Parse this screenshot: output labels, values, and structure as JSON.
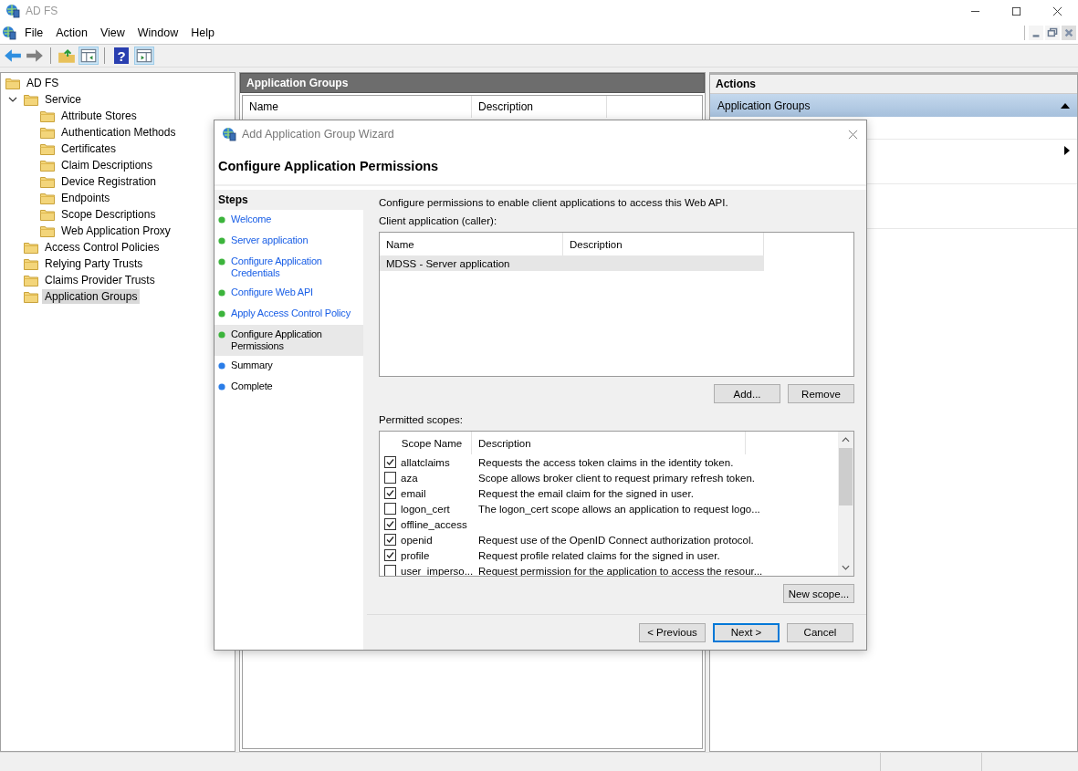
{
  "window": {
    "title": "AD FS"
  },
  "menu": [
    "File",
    "Action",
    "View",
    "Window",
    "Help"
  ],
  "toolbar": {
    "help_glyph": "?"
  },
  "tree": [
    {
      "label": "AD FS",
      "selected": false,
      "children": [
        {
          "label": "Service",
          "selected": false,
          "expanded": true,
          "children": [
            {
              "label": "Attribute Stores",
              "selected": false
            },
            {
              "label": "Authentication Methods",
              "selected": false
            },
            {
              "label": "Certificates",
              "selected": false
            },
            {
              "label": "Claim Descriptions",
              "selected": false
            },
            {
              "label": "Device Registration",
              "selected": false
            },
            {
              "label": "Endpoints",
              "selected": false
            },
            {
              "label": "Scope Descriptions",
              "selected": false
            },
            {
              "label": "Web Application Proxy",
              "selected": false
            }
          ]
        },
        {
          "label": "Access Control Policies",
          "selected": false
        },
        {
          "label": "Relying Party Trusts",
          "selected": false
        },
        {
          "label": "Claims Provider Trusts",
          "selected": false
        },
        {
          "label": "Application Groups",
          "selected": true
        }
      ]
    }
  ],
  "center": {
    "title": "Application Groups",
    "columns": [
      "Name",
      "Description"
    ]
  },
  "actions": {
    "title": "Actions",
    "section": "Application Groups",
    "expanded": true
  },
  "dialog": {
    "title": "Add Application Group Wizard",
    "heading": "Configure Application Permissions",
    "steps_title": "Steps",
    "steps": [
      {
        "label": "Welcome",
        "color": "#3cb43c",
        "selected": false
      },
      {
        "label": "Server application",
        "color": "#3cb43c",
        "selected": false
      },
      {
        "label": "Configure Application Credentials",
        "color": "#3cb43c",
        "selected": false
      },
      {
        "label": "Configure Web API",
        "color": "#3cb43c",
        "selected": false
      },
      {
        "label": "Apply Access Control Policy",
        "color": "#3cb43c",
        "selected": false
      },
      {
        "label": "Configure Application Permissions",
        "color": "#3cb43c",
        "selected": true
      },
      {
        "label": "Summary",
        "color": "#2a7de8",
        "selected": false
      },
      {
        "label": "Complete",
        "color": "#2a7de8",
        "selected": false
      }
    ],
    "intro": "Configure permissions to enable client applications to access this Web API.",
    "client_label": "Client application (caller):",
    "client_columns": [
      "Name",
      "Description"
    ],
    "client_rows": [
      {
        "name": "MDSS - Server application",
        "selected": true
      }
    ],
    "client_buttons": [
      "Add...",
      "Remove"
    ],
    "scopes_label": "Permitted scopes:",
    "scope_columns": [
      "Scope Name",
      "Description"
    ],
    "scopes": [
      {
        "name": "allatclaims",
        "description": "Requests the access token claims in the identity token.",
        "checked": true
      },
      {
        "name": "aza",
        "description": "Scope allows broker client to request primary refresh token.",
        "checked": false
      },
      {
        "name": "email",
        "description": "Request the email claim for the signed in user.",
        "checked": true
      },
      {
        "name": "logon_cert",
        "description": "The logon_cert scope allows an application to request logo...",
        "checked": false
      },
      {
        "name": "offline_access",
        "checked": true
      },
      {
        "name": "openid",
        "description": "Request use of the OpenID Connect authorization protocol.",
        "checked": true
      },
      {
        "name": "profile",
        "description": "Request profile related claims for the signed in user.",
        "checked": true
      },
      {
        "name": "user_imperso...",
        "description": "Request permission for the application to access the resour...",
        "checked": false
      }
    ],
    "new_scope_button": "New scope...",
    "nav_buttons": [
      {
        "label": "< Previous",
        "default": false
      },
      {
        "label": "Next >",
        "default": true
      },
      {
        "label": "Cancel",
        "default": false
      }
    ]
  }
}
